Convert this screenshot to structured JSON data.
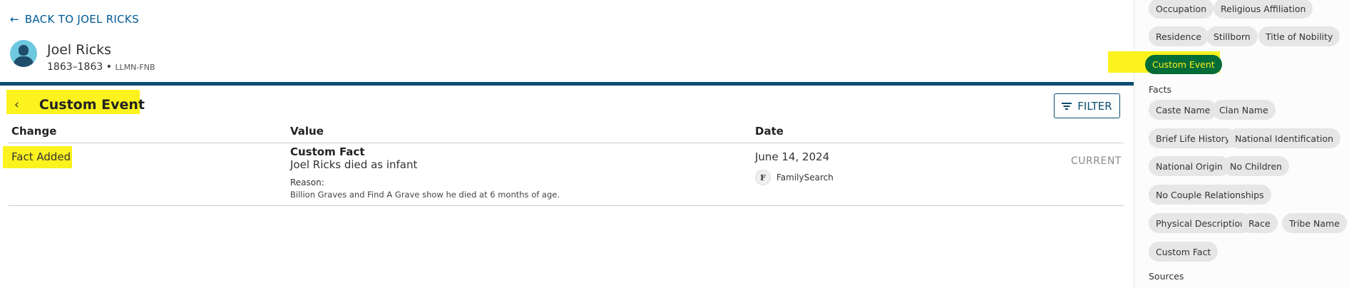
{
  "back_link": {
    "label": "BACK TO JOEL RICKS",
    "icon": "arrow-left-icon"
  },
  "person": {
    "name": "Joel Ricks",
    "lifespan": "1863–1863",
    "separator": "•",
    "pid": "LLMN-FNB"
  },
  "section": {
    "title": "Custom Event",
    "back_icon": "chevron-left-icon"
  },
  "filter_button": {
    "label": "FILTER",
    "icon": "filter-icon"
  },
  "table": {
    "headers": {
      "change": "Change",
      "value": "Value",
      "date": "Date"
    },
    "rows": [
      {
        "change": "Fact Added",
        "value_title": "Custom Fact",
        "value_text": "Joel Ricks died as infant",
        "reason_label": "Reason:",
        "reason_text": "Billion Graves and Find A Grave show he died at 6 months of age.",
        "date": "June 14, 2024",
        "source_initial": "F",
        "source_name": "FamilySearch",
        "status": "CURRENT"
      }
    ]
  },
  "sidebar": {
    "chips_top": [
      "Occupation",
      "Religious Affiliation",
      "Residence",
      "Stillborn",
      "Title of Nobility"
    ],
    "active_chip": "Custom Event",
    "facts_label": "Facts",
    "facts_chips": [
      "Caste Name",
      "Clan Name",
      "Brief Life History",
      "National Identification",
      "National Origin",
      "No Children",
      "No Couple Relationships",
      "Physical Description",
      "Race",
      "Tribe Name",
      "Custom Fact"
    ],
    "sources_label": "Sources"
  },
  "colors": {
    "accent_blue": "#0b4d70",
    "link_blue": "#005994",
    "highlight_yellow": "#fbf21e",
    "active_chip_green": "#046c36"
  }
}
